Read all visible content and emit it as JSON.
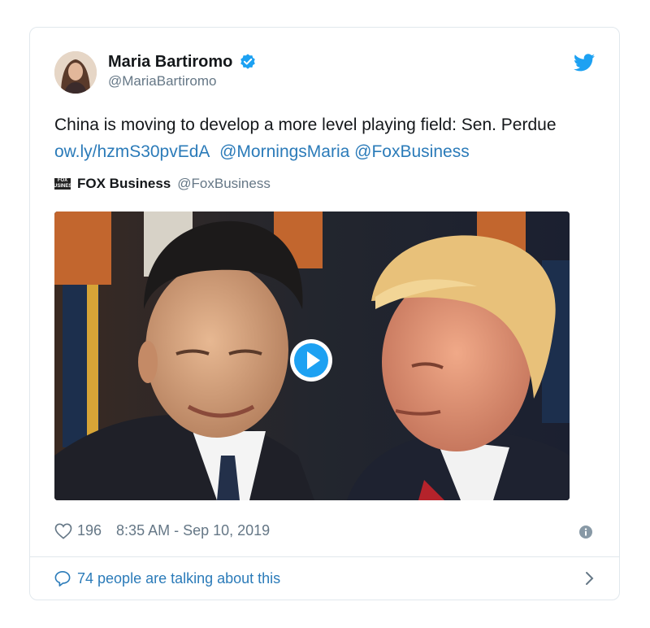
{
  "author": {
    "name": "Maria Bartiromo",
    "handle": "@MariaBartiromo",
    "verified": true
  },
  "tweet": {
    "text_plain": "China is moving to develop a more level playing field: Sen. Perdue ",
    "link": "ow.ly/hzmS30pvEdA",
    "mention1": "@MorningsMaria",
    "mention2": "@FoxBusiness"
  },
  "source": {
    "logo_text": "FOX BUSINESS",
    "name": "FOX Business",
    "handle": "@FoxBusiness"
  },
  "media": {
    "type": "video",
    "play_icon": "play-icon"
  },
  "meta": {
    "likes": "196",
    "timestamp": "8:35 AM - Sep 10, 2019"
  },
  "footer": {
    "conversation_text": "74 people are talking about this"
  },
  "colors": {
    "twitter_blue": "#1da1f2",
    "link": "#2b7bb9",
    "muted": "#657786",
    "border": "#e1e8ed"
  },
  "icons": [
    "twitter-bird-icon",
    "verified-badge-icon",
    "heart-icon",
    "info-icon",
    "speech-bubble-icon",
    "chevron-right-icon",
    "play-icon"
  ]
}
